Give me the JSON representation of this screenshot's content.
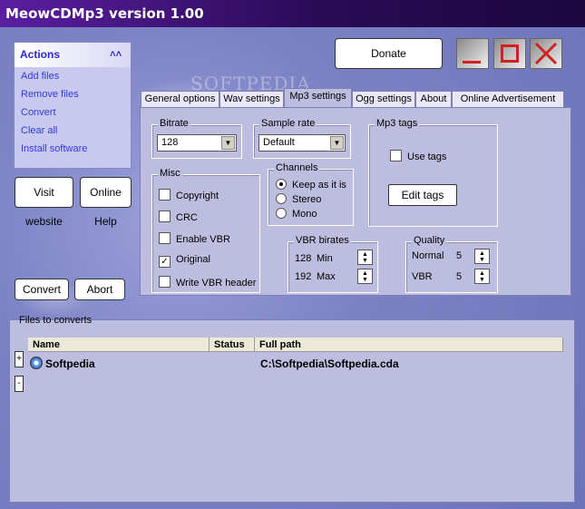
{
  "app": {
    "title": "MeowCDMp3 version 1.00"
  },
  "actions": {
    "header": "Actions",
    "items": [
      {
        "label": "Add files"
      },
      {
        "label": "Remove files"
      },
      {
        "label": "Convert"
      },
      {
        "label": "Clear all"
      },
      {
        "label": "Install software"
      }
    ]
  },
  "buttons": {
    "visit": "Visit website",
    "online_help": "Online Help",
    "convert": "Convert",
    "abort": "Abort",
    "donate": "Donate"
  },
  "tabs": [
    {
      "label": "General options"
    },
    {
      "label": "Wav settings"
    },
    {
      "label": "Mp3 settings"
    },
    {
      "label": "Ogg settings"
    },
    {
      "label": "About"
    },
    {
      "label": "Online  Advertisement"
    }
  ],
  "mp3": {
    "bitrate_label": "Bitrate",
    "bitrate_value": "128",
    "samplerate_label": "Sample rate",
    "samplerate_value": "Default",
    "tags_label": "Mp3 tags",
    "use_tags": "Use tags",
    "edit_tags": "Edit tags",
    "misc_label": "Misc",
    "misc": [
      {
        "label": "Copyright",
        "checked": false
      },
      {
        "label": "CRC",
        "checked": false
      },
      {
        "label": "Enable VBR",
        "checked": false
      },
      {
        "label": "Original",
        "checked": true
      },
      {
        "label": "Write VBR header",
        "checked": false
      }
    ],
    "channels_label": "Channels",
    "channels": [
      {
        "label": "Keep as it is",
        "selected": true
      },
      {
        "label": "Stereo",
        "selected": false
      },
      {
        "label": "Mono",
        "selected": false
      }
    ],
    "vbr_label": "VBR birates",
    "vbr_min_value": "128",
    "vbr_min_label": "Min",
    "vbr_max_value": "192",
    "vbr_max_label": "Max",
    "quality_label": "Quality",
    "quality_normal_label": "Normal",
    "quality_normal_value": "5",
    "quality_vbr_label": "VBR",
    "quality_vbr_value": "5"
  },
  "files": {
    "label": "Files to converts",
    "columns": [
      "Name",
      "Status",
      "Full path"
    ],
    "rows": [
      {
        "name": "Softpedia",
        "status": "",
        "path": "C:\\Softpedia\\Softpedia.cda"
      }
    ],
    "add": "+",
    "remove": "-"
  },
  "watermark": "SOFTPEDIA"
}
